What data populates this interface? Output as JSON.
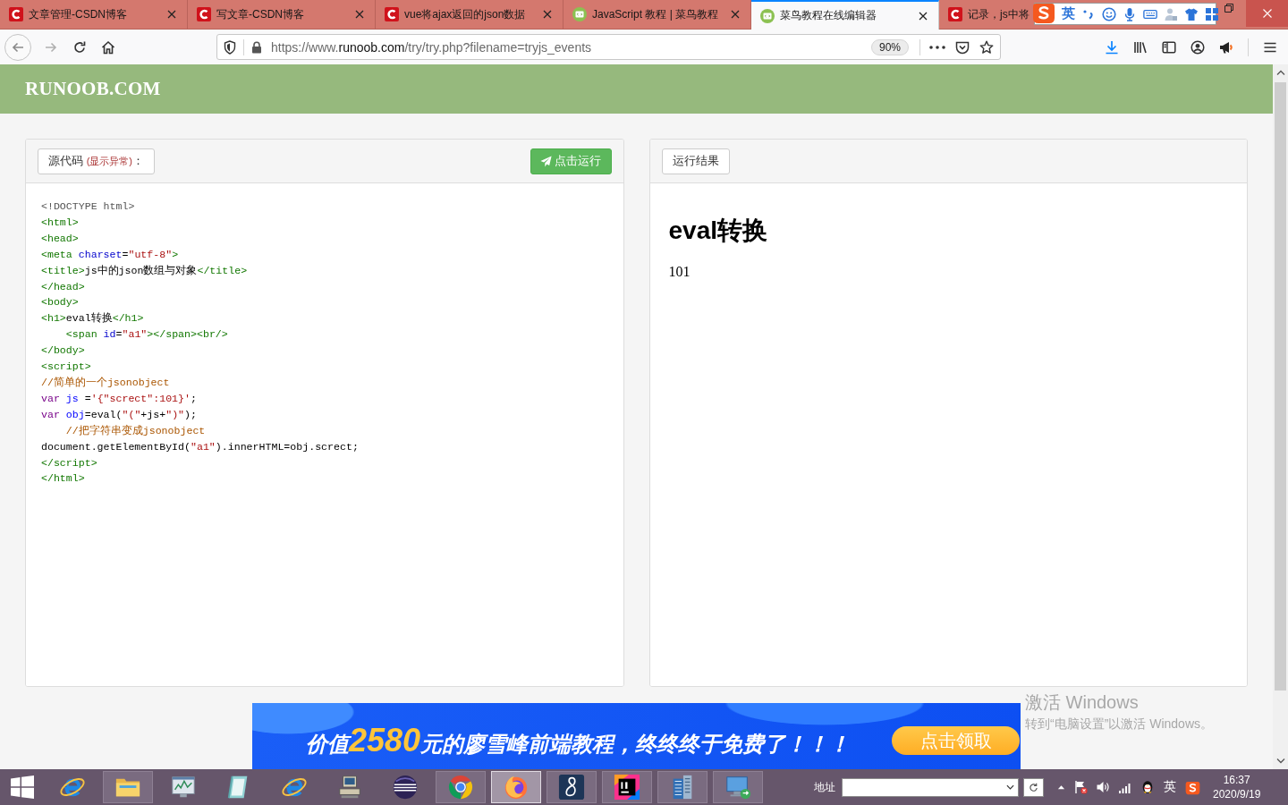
{
  "tab_strip": {
    "tabs": [
      {
        "title": "文章管理-CSDN博客",
        "kind": "letter",
        "selected": false
      },
      {
        "title": "写文章-CSDN博客",
        "kind": "letter",
        "selected": false
      },
      {
        "title": "vue将ajax返回的json数据",
        "kind": "letter",
        "selected": false
      },
      {
        "title": "JavaScript 教程 | 菜鸟教程",
        "kind": "code",
        "selected": false
      },
      {
        "title": "菜鸟教程在线编辑器",
        "kind": "code",
        "selected": true
      },
      {
        "title": "记录，js中将",
        "kind": "letter",
        "selected": false
      }
    ]
  },
  "ime_toolbar": {
    "mode": "英"
  },
  "toolbar": {
    "url": {
      "start": "https://www.",
      "domain": "runoob.com",
      "path": "/try/try.php?filename=tryjs_events"
    },
    "zoom": "90%"
  },
  "page": {
    "logo": "RUNOOB.COM",
    "source_panel": {
      "label": "源代码",
      "note": "(显示异常)",
      "label_end": "：",
      "run_button": "点击运行",
      "code_lines": [
        {
          "tokens": [
            {
              "text": "<!DOCTYPE html>",
              "kind": "meta"
            }
          ]
        },
        {
          "tokens": [
            {
              "text": "<html>",
              "kind": "tag"
            }
          ]
        },
        {
          "tokens": [
            {
              "text": "<head>",
              "kind": "tag"
            }
          ]
        },
        {
          "tokens": [
            {
              "text": "<meta",
              "kind": "tag"
            },
            {
              "text": " charset",
              "kind": "attr"
            },
            {
              "text": "=",
              "kind": "text"
            },
            {
              "text": "\"utf-8\"",
              "kind": "string"
            },
            {
              "text": ">",
              "kind": "tag"
            }
          ]
        },
        {
          "tokens": [
            {
              "text": "<title>",
              "kind": "tag"
            },
            {
              "text": "js中的json数组与对象",
              "kind": "text"
            },
            {
              "text": "</title>",
              "kind": "tag"
            }
          ]
        },
        {
          "tokens": [
            {
              "text": "</head>",
              "kind": "tag"
            }
          ]
        },
        {
          "tokens": [
            {
              "text": "<body>",
              "kind": "tag"
            }
          ]
        },
        {
          "tokens": [
            {
              "text": "<h1>",
              "kind": "tag"
            },
            {
              "text": "eval转换",
              "kind": "text"
            },
            {
              "text": "</h1>",
              "kind": "tag"
            }
          ]
        },
        {
          "tokens": [
            {
              "text": "    <span",
              "kind": "tag"
            },
            {
              "text": " id",
              "kind": "attr"
            },
            {
              "text": "=",
              "kind": "text"
            },
            {
              "text": "\"a1\"",
              "kind": "string"
            },
            {
              "text": "></span><br/>",
              "kind": "tag"
            }
          ]
        },
        {
          "tokens": [
            {
              "text": "</body>",
              "kind": "tag"
            }
          ]
        },
        {
          "tokens": [
            {
              "text": "<script>",
              "kind": "tag"
            }
          ]
        },
        {
          "tokens": [
            {
              "text": "//简单的一个jsonobject",
              "kind": "comment"
            }
          ]
        },
        {
          "tokens": [
            {
              "text": "var",
              "kind": "keyword"
            },
            {
              "text": " js",
              "kind": "def"
            },
            {
              "text": " =",
              "kind": "text"
            },
            {
              "text": "'{\"screct\":101}'",
              "kind": "string"
            },
            {
              "text": ";",
              "kind": "text"
            }
          ]
        },
        {
          "tokens": [
            {
              "text": "var",
              "kind": "keyword"
            },
            {
              "text": " obj",
              "kind": "def"
            },
            {
              "text": "=eval(",
              "kind": "text"
            },
            {
              "text": "\"(\"",
              "kind": "string"
            },
            {
              "text": "+js+",
              "kind": "text"
            },
            {
              "text": "\")\"",
              "kind": "string"
            },
            {
              "text": ");",
              "kind": "text"
            }
          ]
        },
        {
          "tokens": [
            {
              "text": "    //把字符串变成jsonobject",
              "kind": "comment"
            }
          ]
        },
        {
          "tokens": [
            {
              "text": "document.getElementById(",
              "kind": "text"
            },
            {
              "text": "\"a1\"",
              "kind": "string"
            },
            {
              "text": ").innerHTML=obj.screct;",
              "kind": "text"
            }
          ]
        },
        {
          "tokens": [
            {
              "text": "</script>",
              "kind": "tag"
            }
          ]
        },
        {
          "tokens": [
            {
              "text": "</html>",
              "kind": "tag"
            }
          ]
        }
      ]
    },
    "result_panel": {
      "label": "运行结果",
      "heading": "eval转换",
      "output": "101"
    },
    "banner": {
      "before": "价值",
      "highlight": "2580",
      "after": "元的廖雪峰前端教程，终终终于免费了！！！",
      "button": "点击领取"
    }
  },
  "activation_notice": {
    "title": "激活 Windows",
    "text": "转到“电脑设置”以激活 Windows。"
  },
  "taskbar": {
    "apps": [
      {
        "kind": "ie",
        "running": false,
        "selected": false
      },
      {
        "kind": "folder",
        "running": true,
        "selected": false
      },
      {
        "kind": "monitor",
        "running": false,
        "selected": false
      },
      {
        "kind": "notebook",
        "running": false,
        "selected": false
      },
      {
        "kind": "ie",
        "running": false,
        "selected": false
      },
      {
        "kind": "computer",
        "running": false,
        "selected": false
      },
      {
        "kind": "sphere",
        "running": false,
        "selected": false
      },
      {
        "kind": "chrome",
        "running": true,
        "selected": false
      },
      {
        "kind": "firefox",
        "running": true,
        "selected": true
      },
      {
        "kind": "script",
        "running": true,
        "selected": false
      },
      {
        "kind": "ide",
        "running": true,
        "selected": false
      },
      {
        "kind": "building",
        "running": true,
        "selected": false
      },
      {
        "kind": "remote",
        "running": true,
        "selected": false
      }
    ],
    "address_label": "地址",
    "input_language": "英",
    "time": "16:37",
    "date": "2020/9/19"
  }
}
